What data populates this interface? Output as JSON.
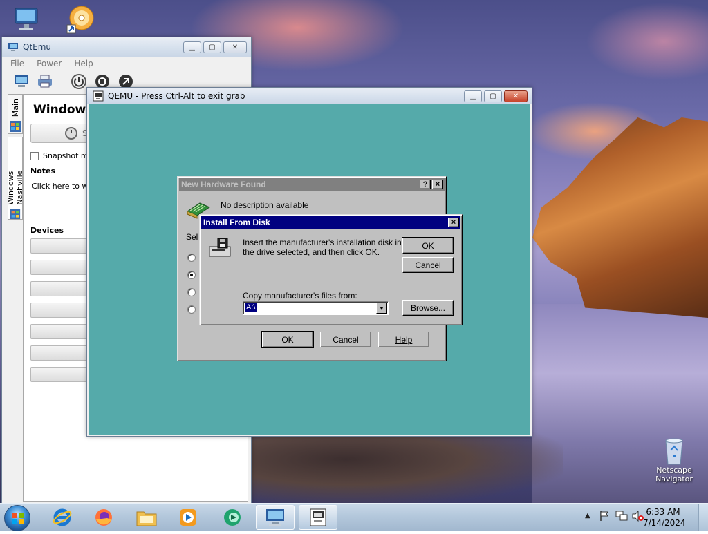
{
  "desktop": {
    "icons": [
      {
        "name": "computer",
        "label": ""
      },
      {
        "name": "setup-cd",
        "label": ""
      },
      {
        "name": "recycle-bin",
        "label": "Netscape\nNavigator"
      }
    ],
    "recycle_label_line1": "Netscape",
    "recycle_label_line2": "Navigator"
  },
  "qtemu": {
    "title": "QtEmu",
    "menu": [
      "File",
      "Power",
      "Help"
    ],
    "toolbar_icons": [
      "machine-icon",
      "printer-icon",
      "power-icon",
      "pause-icon",
      "stop-icon"
    ],
    "vtabs": [
      "Main",
      "Windows Nashville"
    ],
    "machine_title": "Windows",
    "start_label": "St",
    "snapshot_label": "Snapshot mo",
    "notes_heading": "Notes",
    "notes_placeholder": "Click here to writ",
    "devices_heading": "Devices"
  },
  "qemu": {
    "title": "QEMU - Press Ctrl-Alt to exit grab"
  },
  "new_hardware": {
    "title": "New Hardware Found",
    "description": "No description available",
    "select_prefix": "Sel",
    "radio_selected_index": 1,
    "ok_label": "OK",
    "cancel_label": "Cancel",
    "help_label": "Help",
    "help_btn": "?",
    "close_btn": "×"
  },
  "install_disk": {
    "title": "Install From Disk",
    "message_line1": "Insert the manufacturer's installation disk into",
    "message_line2": "the drive selected, and then click OK.",
    "copy_label": "Copy manufacturer's files from:",
    "path_value": "A:\\",
    "ok_label": "OK",
    "cancel_label": "Cancel",
    "browse_label": "Browse...",
    "close_btn": "×"
  },
  "taskbar": {
    "pinned": [
      "internet-explorer-icon",
      "firefox-icon",
      "file-explorer-icon",
      "media-player-icon",
      "messenger-icon",
      "qtemu-icon",
      "qemu-icon"
    ],
    "time": "6:33 AM",
    "date": "7/14/2024",
    "tray": [
      "show-hidden-icon",
      "flag-icon",
      "network-icon",
      "volume-muted-icon"
    ]
  },
  "colors": {
    "qemu_screen": "#55aaaa",
    "win95_face": "#c0c0c0",
    "active_caption": "#000080",
    "inactive_caption": "#808080"
  }
}
